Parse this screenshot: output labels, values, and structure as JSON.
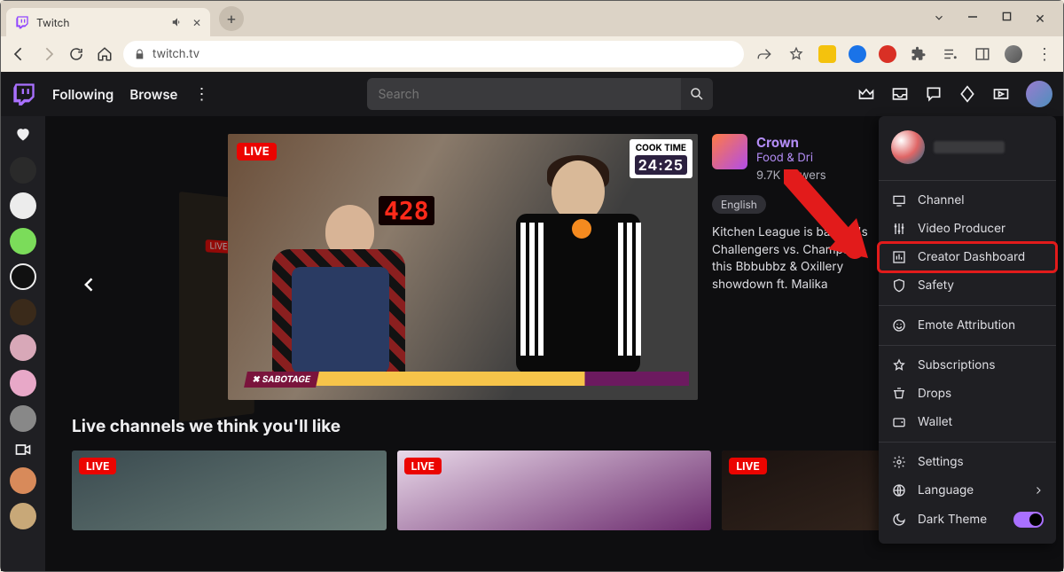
{
  "browser": {
    "tab_title": "Twitch",
    "url": "twitch.tv",
    "new_tab_glyph": "+"
  },
  "topnav": {
    "following": "Following",
    "browse": "Browse",
    "search_placeholder": "Search"
  },
  "hero": {
    "live_label": "LIVE",
    "cook_label": "COOK TIME",
    "cook_time": "24:25",
    "clock_digits": "428",
    "sabotage_label": "✖ SABOTAGE",
    "stream_title": "Crown",
    "category": "Food & Dri",
    "viewers": "9.7K viewers",
    "language_tag": "English",
    "description": "Kitchen League is back! It's Challengers vs. Champs in this Bbbubbz & Oxillery showdown ft. Malika"
  },
  "section_heading": "Live channels we think you'll like",
  "cards": {
    "live_label": "LIVE"
  },
  "dropdown": {
    "channel": "Channel",
    "video_producer": "Video Producer",
    "creator_dashboard": "Creator Dashboard",
    "safety": "Safety",
    "emote_attribution": "Emote Attribution",
    "subscriptions": "Subscriptions",
    "drops": "Drops",
    "wallet": "Wallet",
    "settings": "Settings",
    "language": "Language",
    "dark_theme": "Dark Theme"
  }
}
